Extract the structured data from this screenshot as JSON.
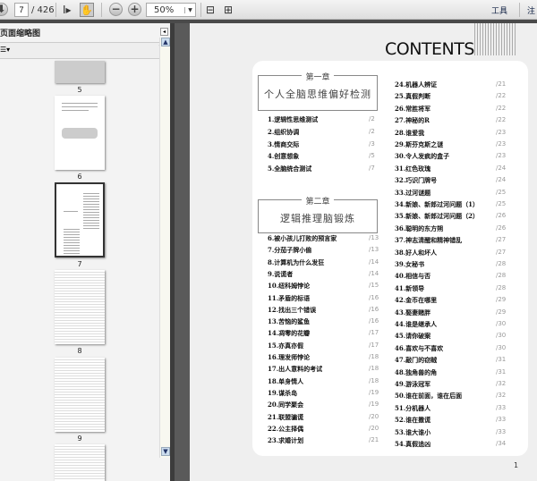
{
  "toolbar": {
    "page_current": "7",
    "page_total": "/ 426",
    "zoom": "50%",
    "tools_label": "工具",
    "comment_label": "注"
  },
  "panel": {
    "title": "页面缩略图",
    "thumbnails": [
      {
        "label": "5"
      },
      {
        "label": "6"
      },
      {
        "label": "7"
      },
      {
        "label": "8"
      },
      {
        "label": "9"
      }
    ]
  },
  "document": {
    "title": "CONTENTS",
    "page_number": "1",
    "chapter1": {
      "number": "第一章",
      "title": "个人全脑思维偏好检测"
    },
    "chapter2": {
      "number": "第二章",
      "title": "逻辑推理脑锻炼"
    },
    "entries_ch1": [
      [
        "1.逻辑性思维测试",
        "/2"
      ],
      [
        "2.组织协调",
        "/2"
      ],
      [
        "3.情商交际",
        "/3"
      ],
      [
        "4.创意想象",
        "/5"
      ],
      [
        "5.全脑统合测试",
        "/7"
      ]
    ],
    "entries_ch2": [
      [
        "6.被小孩儿打败的预言家",
        "/13"
      ],
      [
        "7.分茄子牌小偷",
        "/13"
      ],
      [
        "8.计算机为什么发狂",
        "/14"
      ],
      [
        "9.说谎者",
        "/14"
      ],
      [
        "10.纽科姆悖论",
        "/15"
      ],
      [
        "11.矛盾的标语",
        "/16"
      ],
      [
        "12.找出三个错误",
        "/16"
      ],
      [
        "13.苦恼的鲨鱼",
        "/16"
      ],
      [
        "14.凋零的花瓣",
        "/17"
      ],
      [
        "15.亦真亦假",
        "/17"
      ],
      [
        "16.理发师悖论",
        "/18"
      ],
      [
        "17.出人意料的考试",
        "/18"
      ],
      [
        "18.单身情人",
        "/18"
      ],
      [
        "19.谋杀岛",
        "/19"
      ],
      [
        "20.同学聚会",
        "/19"
      ],
      [
        "21.联盟骗谎",
        "/20"
      ],
      [
        "22.公主择偶",
        "/20"
      ],
      [
        "23.求婚计划",
        "/21"
      ]
    ],
    "entries_right": [
      [
        "24.机器人辨证",
        "/21"
      ],
      [
        "25.真假判断",
        "/22"
      ],
      [
        "26.常胜将军",
        "/22"
      ],
      [
        "27.神秘的R",
        "/22"
      ],
      [
        "28.谁爱我",
        "/23"
      ],
      [
        "29.斯芬克斯之谜",
        "/23"
      ],
      [
        "30.令人发疯的盒子",
        "/23"
      ],
      [
        "31.红色玫瑰",
        "/24"
      ],
      [
        "32.巧识门牌号",
        "/24"
      ],
      [
        "33.过河谜题",
        "/25"
      ],
      [
        "34.新娘、新郎过河问题（1）",
        "/25"
      ],
      [
        "35.新娘、新郎过河问题（2）",
        "/26"
      ],
      [
        "36.聪明的东方朔",
        "/26"
      ],
      [
        "37.神志清醒和精神错乱",
        "/27"
      ],
      [
        "38.好人和坏人",
        "/27"
      ],
      [
        "39.女秘书",
        "/28"
      ],
      [
        "40.相信与否",
        "/28"
      ],
      [
        "41.新领导",
        "/28"
      ],
      [
        "42.金币在哪里",
        "/29"
      ],
      [
        "43.娶妻赌胖",
        "/29"
      ],
      [
        "44.谁是继承人",
        "/30"
      ],
      [
        "45.请你破案",
        "/30"
      ],
      [
        "46.喜欢与不喜欢",
        "/30"
      ],
      [
        "47.敲门的窃贼",
        "/31"
      ],
      [
        "48.独角兽的角",
        "/31"
      ],
      [
        "49.游泳冠军",
        "/32"
      ],
      [
        "50.谁在前面，谁在后面",
        "/32"
      ],
      [
        "51.分机器人",
        "/33"
      ],
      [
        "52.谁在撒谎",
        "/33"
      ],
      [
        "53.谁大谁小",
        "/33"
      ],
      [
        "54.真假追凶",
        "/34"
      ]
    ]
  }
}
